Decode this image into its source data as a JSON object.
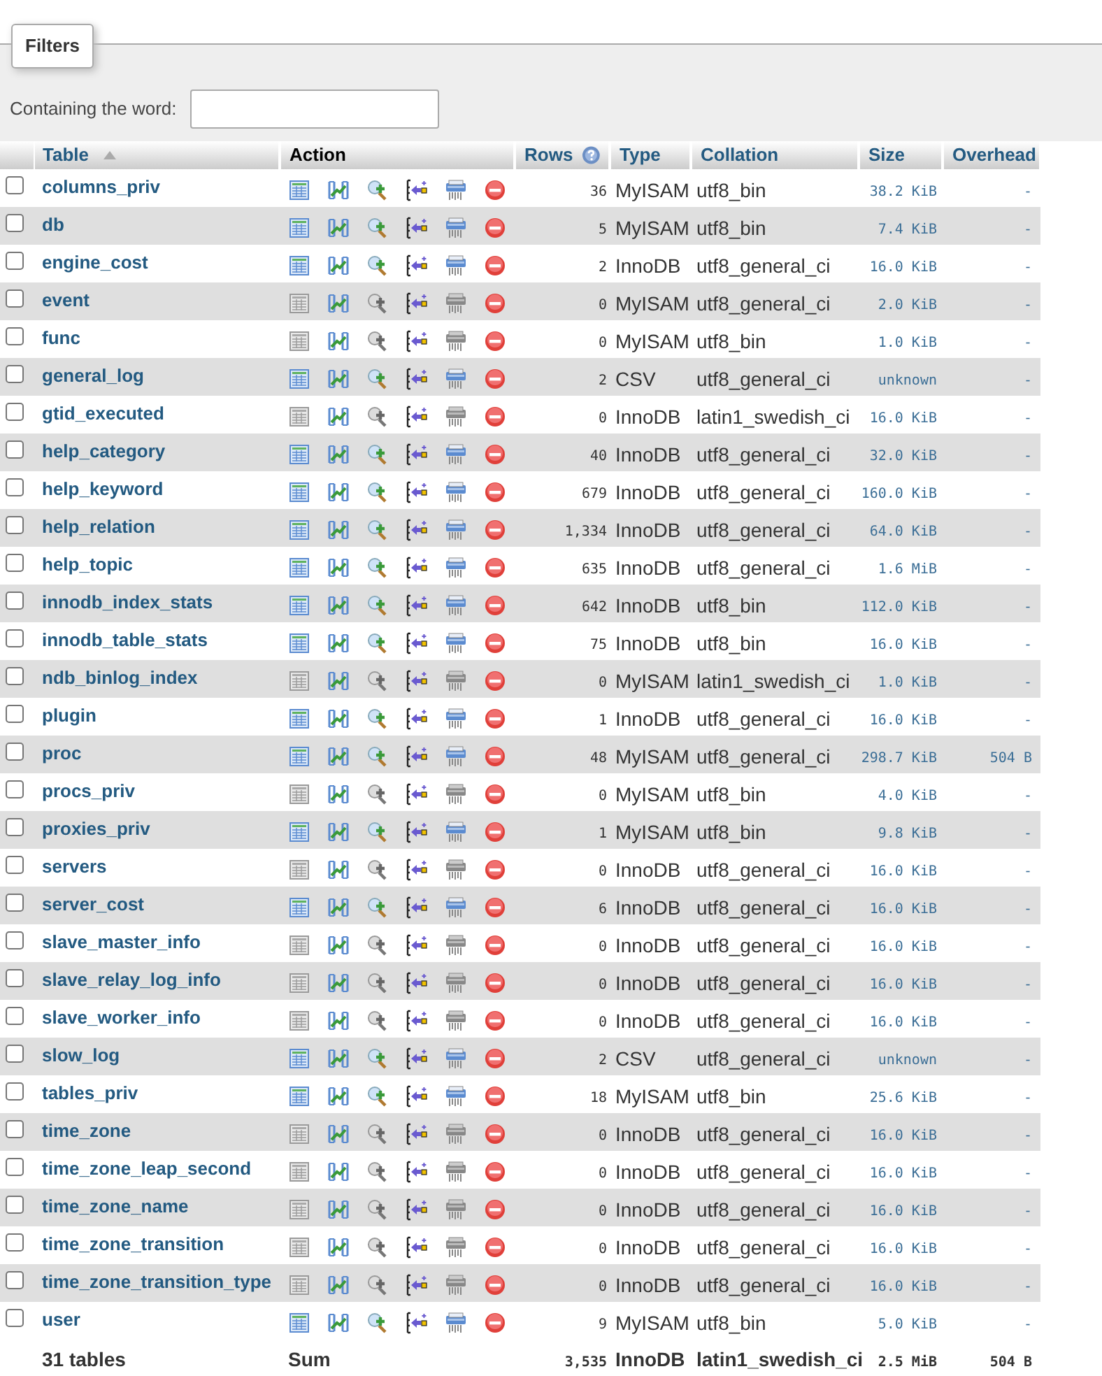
{
  "filters": {
    "legend": "Filters",
    "label": "Containing the word:"
  },
  "columns": [
    {
      "label": "Table",
      "sorted": true
    },
    {
      "label": "Action"
    },
    {
      "label": "Rows",
      "help": true
    },
    {
      "label": "Type"
    },
    {
      "label": "Collation"
    },
    {
      "label": "Size"
    },
    {
      "label": "Overhead"
    }
  ],
  "rows": [
    {
      "checked": false,
      "name": "columns_priv",
      "empty": false,
      "rows": "36",
      "type": "MyISAM",
      "collation": "utf8_bin",
      "size": "38.2 KiB",
      "overhead": "-"
    },
    {
      "checked": false,
      "name": "db",
      "empty": false,
      "rows": "5",
      "type": "MyISAM",
      "collation": "utf8_bin",
      "size": "7.4 KiB",
      "overhead": "-"
    },
    {
      "checked": false,
      "name": "engine_cost",
      "empty": false,
      "rows": "2",
      "type": "InnoDB",
      "collation": "utf8_general_ci",
      "size": "16.0 KiB",
      "overhead": "-"
    },
    {
      "checked": false,
      "name": "event",
      "empty": true,
      "rows": "0",
      "type": "MyISAM",
      "collation": "utf8_general_ci",
      "size": "2.0 KiB",
      "overhead": "-"
    },
    {
      "checked": false,
      "name": "func",
      "empty": true,
      "rows": "0",
      "type": "MyISAM",
      "collation": "utf8_bin",
      "size": "1.0 KiB",
      "overhead": "-"
    },
    {
      "checked": false,
      "name": "general_log",
      "empty": false,
      "rows": "2",
      "type": "CSV",
      "collation": "utf8_general_ci",
      "size": "unknown",
      "overhead": "-"
    },
    {
      "checked": false,
      "name": "gtid_executed",
      "empty": true,
      "rows": "0",
      "type": "InnoDB",
      "collation": "latin1_swedish_ci",
      "size": "16.0 KiB",
      "overhead": "-"
    },
    {
      "checked": false,
      "name": "help_category",
      "empty": false,
      "rows": "40",
      "type": "InnoDB",
      "collation": "utf8_general_ci",
      "size": "32.0 KiB",
      "overhead": "-"
    },
    {
      "checked": false,
      "name": "help_keyword",
      "empty": false,
      "rows": "679",
      "type": "InnoDB",
      "collation": "utf8_general_ci",
      "size": "160.0 KiB",
      "overhead": "-"
    },
    {
      "checked": false,
      "name": "help_relation",
      "empty": false,
      "rows": "1,334",
      "type": "InnoDB",
      "collation": "utf8_general_ci",
      "size": "64.0 KiB",
      "overhead": "-"
    },
    {
      "checked": false,
      "name": "help_topic",
      "empty": false,
      "rows": "635",
      "type": "InnoDB",
      "collation": "utf8_general_ci",
      "size": "1.6 MiB",
      "overhead": "-"
    },
    {
      "checked": false,
      "name": "innodb_index_stats",
      "empty": false,
      "rows": "642",
      "type": "InnoDB",
      "collation": "utf8_bin",
      "size": "112.0 KiB",
      "overhead": "-"
    },
    {
      "checked": false,
      "name": "innodb_table_stats",
      "empty": false,
      "rows": "75",
      "type": "InnoDB",
      "collation": "utf8_bin",
      "size": "16.0 KiB",
      "overhead": "-"
    },
    {
      "checked": false,
      "name": "ndb_binlog_index",
      "empty": true,
      "rows": "0",
      "type": "MyISAM",
      "collation": "latin1_swedish_ci",
      "size": "1.0 KiB",
      "overhead": "-"
    },
    {
      "checked": false,
      "name": "plugin",
      "empty": false,
      "rows": "1",
      "type": "InnoDB",
      "collation": "utf8_general_ci",
      "size": "16.0 KiB",
      "overhead": "-"
    },
    {
      "checked": false,
      "name": "proc",
      "empty": false,
      "rows": "48",
      "type": "MyISAM",
      "collation": "utf8_general_ci",
      "size": "298.7 KiB",
      "overhead": "504 B"
    },
    {
      "checked": false,
      "name": "procs_priv",
      "empty": true,
      "rows": "0",
      "type": "MyISAM",
      "collation": "utf8_bin",
      "size": "4.0 KiB",
      "overhead": "-"
    },
    {
      "checked": false,
      "name": "proxies_priv",
      "empty": false,
      "rows": "1",
      "type": "MyISAM",
      "collation": "utf8_bin",
      "size": "9.8 KiB",
      "overhead": "-"
    },
    {
      "checked": false,
      "name": "servers",
      "empty": true,
      "rows": "0",
      "type": "InnoDB",
      "collation": "utf8_general_ci",
      "size": "16.0 KiB",
      "overhead": "-"
    },
    {
      "checked": false,
      "name": "server_cost",
      "empty": false,
      "rows": "6",
      "type": "InnoDB",
      "collation": "utf8_general_ci",
      "size": "16.0 KiB",
      "overhead": "-"
    },
    {
      "checked": false,
      "name": "slave_master_info",
      "empty": true,
      "rows": "0",
      "type": "InnoDB",
      "collation": "utf8_general_ci",
      "size": "16.0 KiB",
      "overhead": "-"
    },
    {
      "checked": false,
      "name": "slave_relay_log_info",
      "empty": true,
      "rows": "0",
      "type": "InnoDB",
      "collation": "utf8_general_ci",
      "size": "16.0 KiB",
      "overhead": "-"
    },
    {
      "checked": false,
      "name": "slave_worker_info",
      "empty": true,
      "rows": "0",
      "type": "InnoDB",
      "collation": "utf8_general_ci",
      "size": "16.0 KiB",
      "overhead": "-"
    },
    {
      "checked": false,
      "name": "slow_log",
      "empty": false,
      "rows": "2",
      "type": "CSV",
      "collation": "utf8_general_ci",
      "size": "unknown",
      "overhead": "-"
    },
    {
      "checked": false,
      "name": "tables_priv",
      "empty": false,
      "rows": "18",
      "type": "MyISAM",
      "collation": "utf8_bin",
      "size": "25.6 KiB",
      "overhead": "-"
    },
    {
      "checked": false,
      "name": "time_zone",
      "empty": true,
      "rows": "0",
      "type": "InnoDB",
      "collation": "utf8_general_ci",
      "size": "16.0 KiB",
      "overhead": "-"
    },
    {
      "checked": false,
      "name": "time_zone_leap_second",
      "empty": true,
      "rows": "0",
      "type": "InnoDB",
      "collation": "utf8_general_ci",
      "size": "16.0 KiB",
      "overhead": "-"
    },
    {
      "checked": false,
      "name": "time_zone_name",
      "empty": true,
      "rows": "0",
      "type": "InnoDB",
      "collation": "utf8_general_ci",
      "size": "16.0 KiB",
      "overhead": "-"
    },
    {
      "checked": false,
      "name": "time_zone_transition",
      "empty": true,
      "rows": "0",
      "type": "InnoDB",
      "collation": "utf8_general_ci",
      "size": "16.0 KiB",
      "overhead": "-"
    },
    {
      "checked": false,
      "name": "time_zone_transition_type",
      "empty": true,
      "rows": "0",
      "type": "InnoDB",
      "collation": "utf8_general_ci",
      "size": "16.0 KiB",
      "overhead": "-"
    },
    {
      "checked": false,
      "name": "user",
      "empty": false,
      "rows": "9",
      "type": "MyISAM",
      "collation": "utf8_bin",
      "size": "5.0 KiB",
      "overhead": "-"
    }
  ],
  "footer": {
    "count": "31 tables",
    "label": "Sum",
    "rows": "3,535",
    "type": "InnoDB",
    "collation": "latin1_swedish_ci",
    "size": "2.5 MiB",
    "overhead": "504 B"
  }
}
